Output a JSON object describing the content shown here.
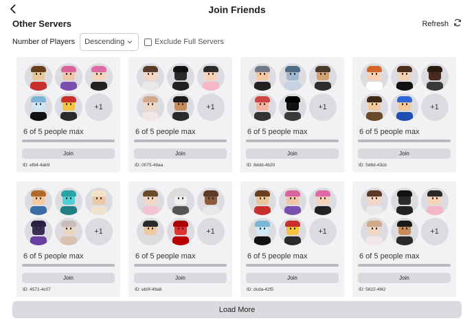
{
  "header": {
    "title": "Join Friends",
    "back_icon": "chevron-left-icon"
  },
  "section": {
    "title": "Other Servers",
    "refresh_label": "Refresh",
    "refresh_icon": "refresh-icon"
  },
  "filters": {
    "players_label": "Number of Players",
    "sort_selected": "Descending",
    "exclude_full_label": "Exclude Full Servers",
    "exclude_full_checked": false
  },
  "more_avatars": "+1",
  "join_label": "Join",
  "servers": [
    {
      "people": "6 of 5 people max",
      "id": "ID: efb4-4ab9"
    },
    {
      "people": "6 of 5 people max",
      "id": "ID: 0075-49aa"
    },
    {
      "people": "6 of 5 people max",
      "id": "ID: 8ddd-4b20"
    },
    {
      "people": "6 of 5 people max",
      "id": "ID: 5d8d-43cb"
    },
    {
      "people": "6 of 5 people max",
      "id": "ID: 4571-4c07"
    },
    {
      "people": "6 of 5 people max",
      "id": "ID: eb0f-49a8"
    },
    {
      "people": "6 of 5 people max",
      "id": "ID: dcda-42f5"
    },
    {
      "people": "6 of 5 people max",
      "id": "ID: 5822-4f42"
    }
  ],
  "load_more_label": "Load More"
}
